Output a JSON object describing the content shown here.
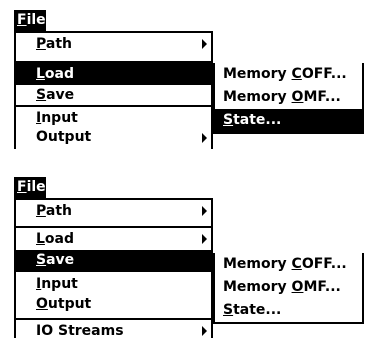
{
  "panels": [
    {
      "menubar": {
        "title": "File",
        "mnemonic": "F",
        "rest": "ile"
      },
      "menu_items": [
        {
          "label": "Path",
          "mn": "P",
          "rest": "ath",
          "submenu": true
        },
        {
          "label": "Load",
          "mn": "L",
          "rest": "oad",
          "selected": true
        },
        {
          "label": "Save",
          "mn": "S",
          "rest": "ave"
        },
        {
          "label": "Input",
          "mn": "I",
          "rest": "nput"
        },
        {
          "label": "Output",
          "mn": "",
          "rest": "Output",
          "submenu": true
        }
      ],
      "submenu_items": [
        {
          "pre": "Memory ",
          "mn": "C",
          "post": "OFF..."
        },
        {
          "pre": "Memory ",
          "mn": "O",
          "post": "MF..."
        },
        {
          "pre": "",
          "mn": "S",
          "post": "tate...",
          "selected": true
        }
      ]
    },
    {
      "menubar": {
        "title": "File",
        "mnemonic": "F",
        "rest": "ile"
      },
      "menu_items": [
        {
          "label": "Path",
          "mn": "P",
          "rest": "ath",
          "submenu": true
        },
        {
          "label": "Load",
          "mn": "L",
          "rest": "oad",
          "submenu": true
        },
        {
          "label": "Save",
          "mn": "S",
          "rest": "ave",
          "selected": true
        },
        {
          "label": "Input",
          "mn": "I",
          "rest": "nput"
        },
        {
          "label": "Output",
          "mn": "O",
          "rest": "utput"
        },
        {
          "label": "IO Streams",
          "mn": "",
          "rest": "IO Streams",
          "submenu": true
        }
      ],
      "submenu_items": [
        {
          "pre": "Memory ",
          "mn": "C",
          "post": "OFF..."
        },
        {
          "pre": "Memory ",
          "mn": "O",
          "post": "MF..."
        },
        {
          "pre": "",
          "mn": "S",
          "post": "tate..."
        }
      ]
    }
  ]
}
